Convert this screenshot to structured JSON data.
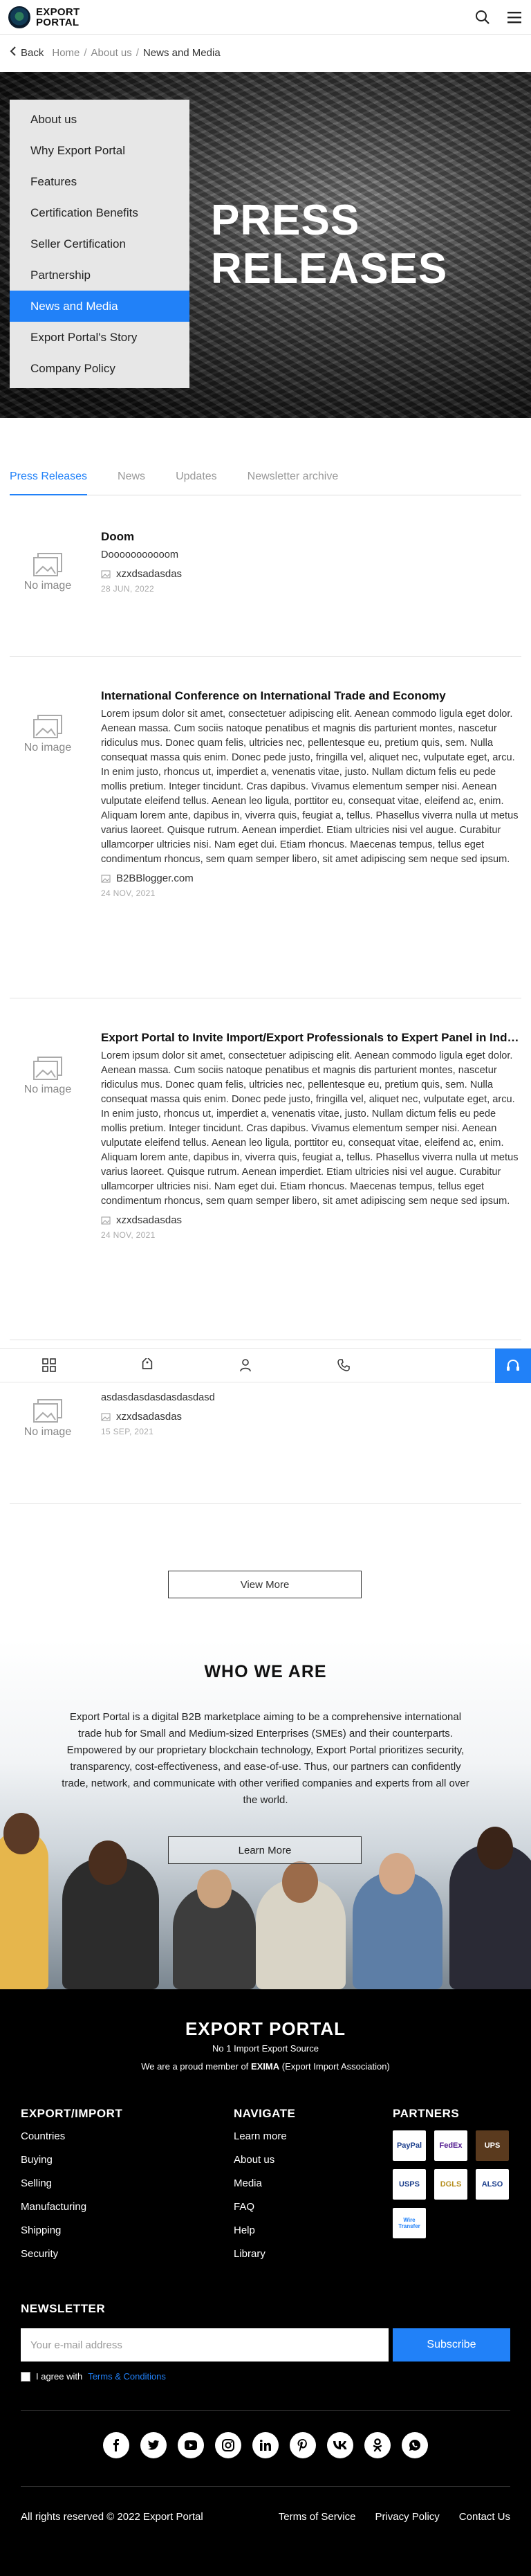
{
  "header": {
    "logo_line1": "EXPORT",
    "logo_line2": "PORTAL"
  },
  "breadcrumb": {
    "back": "Back",
    "items": [
      "Home",
      "About us",
      "News and Media"
    ]
  },
  "hero": {
    "title_line1": "PRESS",
    "title_line2": "RELEASES"
  },
  "side_menu": [
    "About us",
    "Why Export Portal",
    "Features",
    "Certification Benefits",
    "Seller Certification",
    "Partnership",
    "News and Media",
    "Export Portal's Story",
    "Company Policy"
  ],
  "side_menu_active": 6,
  "tabs": [
    "Press Releases",
    "News",
    "Updates",
    "Newsletter archive"
  ],
  "no_image_label": "No image",
  "articles": [
    {
      "title": "Doom",
      "text": "Dooooooooooom",
      "source": "xzxdsadasdas",
      "date": "28 JUN, 2022"
    },
    {
      "title": "International Conference on International Trade and Economy",
      "text": "Lorem ipsum dolor sit amet, consectetuer adipiscing elit. Aenean commodo ligula eget dolor. Aenean massa. Cum sociis natoque penatibus et magnis dis parturient montes, nascetur ridiculus mus. Donec quam felis, ultricies nec, pellentesque eu, pretium quis, sem. Nulla consequat massa quis enim. Donec pede justo, fringilla vel, aliquet nec, vulputate eget, arcu. In enim justo, rhoncus ut, imperdiet a, venenatis vitae, justo. Nullam dictum felis eu pede mollis pretium. Integer tincidunt. Cras dapibus. Vivamus elementum semper nisi. Aenean vulputate eleifend tellus. Aenean leo ligula, porttitor eu, consequat vitae, eleifend ac, enim. Aliquam lorem ante, dapibus in, viverra quis, feugiat a, tellus. Phasellus viverra nulla ut metus varius laoreet. Quisque rutrum. Aenean imperdiet. Etiam ultricies nisi vel augue. Curabitur ullamcorper ultricies nisi. Nam eget dui. Etiam rhoncus. Maecenas tempus, tellus eget condimentum rhoncus, sem quam semper libero, sit amet adipiscing sem neque sed ipsum.",
      "source": "B2BBlogger.com",
      "date": "24 NOV, 2021"
    },
    {
      "title": "Export Portal to Invite Import/Export Professionals to Expert Panel in Indo...",
      "text": "Lorem ipsum dolor sit amet, consectetuer adipiscing elit. Aenean commodo ligula eget dolor. Aenean massa. Cum sociis natoque penatibus et magnis dis parturient montes, nascetur ridiculus mus. Donec quam felis, ultricies nec, pellentesque eu, pretium quis, sem. Nulla consequat massa quis enim. Donec pede justo, fringilla vel, aliquet nec, vulputate eget, arcu. In enim justo, rhoncus ut, imperdiet a, venenatis vitae, justo. Nullam dictum felis eu pede mollis pretium. Integer tincidunt. Cras dapibus. Vivamus elementum semper nisi. Aenean vulputate eleifend tellus. Aenean leo ligula, porttitor eu, consequat vitae, eleifend ac, enim. Aliquam lorem ante, dapibus in, viverra quis, feugiat a, tellus. Phasellus viverra nulla ut metus varius laoreet. Quisque rutrum. Aenean imperdiet. Etiam ultricies nisi vel augue. Curabitur ullamcorper ultricies nisi. Nam eget dui. Etiam rhoncus. Maecenas tempus, tellus eget condimentum rhoncus, sem quam semper libero, sit amet adipiscing sem neque sed ipsum.",
      "source": "xzxdsadasdas",
      "date": "24 NOV, 2021"
    },
    {
      "title": "",
      "text": "asdasdasdasdasdasdasd",
      "source": "xzxdsadasdas",
      "date": "15 SEP, 2021"
    }
  ],
  "view_more": "View More",
  "who": {
    "title": "WHO WE ARE",
    "text": "Export Portal is a digital B2B marketplace aiming to be a comprehensive international trade hub for Small and Medium-sized Enterprises (SMEs) and their counterparts. Empowered by our proprietary blockchain technology, Export Portal prioritizes security, transparency, cost-effectiveness, and ease-of-use. Thus, our partners can confidently trade, network, and communicate with other verified companies and experts from all over the world.",
    "button": "Learn More"
  },
  "footer": {
    "brand": "EXPORT PORTAL",
    "tagline": "No 1 Import Export Source",
    "member_prefix": "We are a proud member of",
    "member_bold": "EXIMA",
    "member_suffix": "(Export Import Association)",
    "col1_title": "EXPORT/IMPORT",
    "col1_links": [
      "Countries",
      "Buying",
      "Selling",
      "Manufacturing",
      "Shipping",
      "Security"
    ],
    "col2_title": "NAVIGATE",
    "col2_links": [
      "Learn more",
      "About us",
      "Media",
      "FAQ",
      "Help",
      "Library"
    ],
    "col3_title": "PARTNERS",
    "partners": [
      "PayPal",
      "FedEx",
      "UPS",
      "USPS",
      "DGLS",
      "ALSO",
      "Wire Transfer"
    ],
    "newsletter_title": "NEWSLETTER",
    "email_placeholder": "Your e-mail address",
    "subscribe": "Subscribe",
    "agree_prefix": "I agree with",
    "agree_link": "Terms & Conditions",
    "socials": [
      "facebook-icon",
      "twitter-icon",
      "youtube-icon",
      "instagram-icon",
      "linkedin-icon",
      "pinterest-icon",
      "vk-icon",
      "odnoklassniki-icon",
      "whatsapp-icon"
    ],
    "copyright": "All rights reserved © 2022 Export Portal",
    "legal": [
      "Terms of Service",
      "Privacy Policy",
      "Contact Us"
    ]
  },
  "colors": {
    "accent": "#2181f8",
    "footer_bg": "#000000"
  }
}
